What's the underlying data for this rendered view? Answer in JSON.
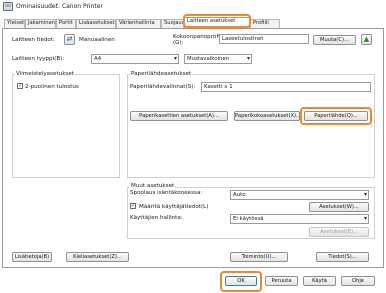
{
  "window": {
    "title": "Ominaisuudet: Canon Printer"
  },
  "tabs": [
    {
      "label": "Yleiset"
    },
    {
      "label": "Jakaminen"
    },
    {
      "label": "Portit"
    },
    {
      "label": "Lisäasetukset"
    },
    {
      "label": "Värienhallinta"
    },
    {
      "label": "Suojaus"
    },
    {
      "label": "Laitteen asetukset"
    },
    {
      "label": "Profiili"
    }
  ],
  "device_info": {
    "label": "Laitteen tiedot:",
    "mode": "Manuaalinen",
    "config_profile_label": "Kokoonpanoprofiili (G):",
    "config_profile_value": "Laseetulostinet",
    "change_button": "Muuta(C)..."
  },
  "device_type": {
    "label": "Laitteen tyyppi(B):",
    "value1": "A4",
    "value2": "Mustavalkoinen"
  },
  "recent_settings": {
    "title": "Viimeistelyasetukset",
    "duplex_label": "2-puolinen tulostus",
    "duplex_checked": true
  },
  "paper_source": {
    "title": "Paperilähdeasetukset",
    "label": "Paperilähdevalinnat(S):",
    "value": "Kasetti x 1",
    "btn_cassette": "Paperikasettien asetukset(A)...",
    "btn_paper_size": "Paperikokoasetukset(X)...",
    "btn_paper_source": "Paperilähde(Q)..."
  },
  "other_settings": {
    "title": "Muut asetukset",
    "spool_label": "Spoolaus isäntäkoneessa:",
    "spool_value": "Auto",
    "define_admin_label": "Määritä käyttäjätiedot(L)",
    "define_admin_checked": true,
    "settings_button": "Asetukset(W)...",
    "user_mgmt_label": "Käyttäjien hallinta:",
    "user_mgmt_value": "Ei käytössä",
    "settings_button2": "Asetukset(E)..."
  },
  "bottom_buttons": {
    "extras": "Lisätietoja(B)",
    "language": "Kieliasetukset(Z)...",
    "function": "Toiminto(U)...",
    "info": "Tiedot(S)..."
  },
  "dialog_buttons": {
    "ok": "OK",
    "cancel": "Peruuta",
    "apply": "Käytä",
    "help": "Ohje"
  }
}
